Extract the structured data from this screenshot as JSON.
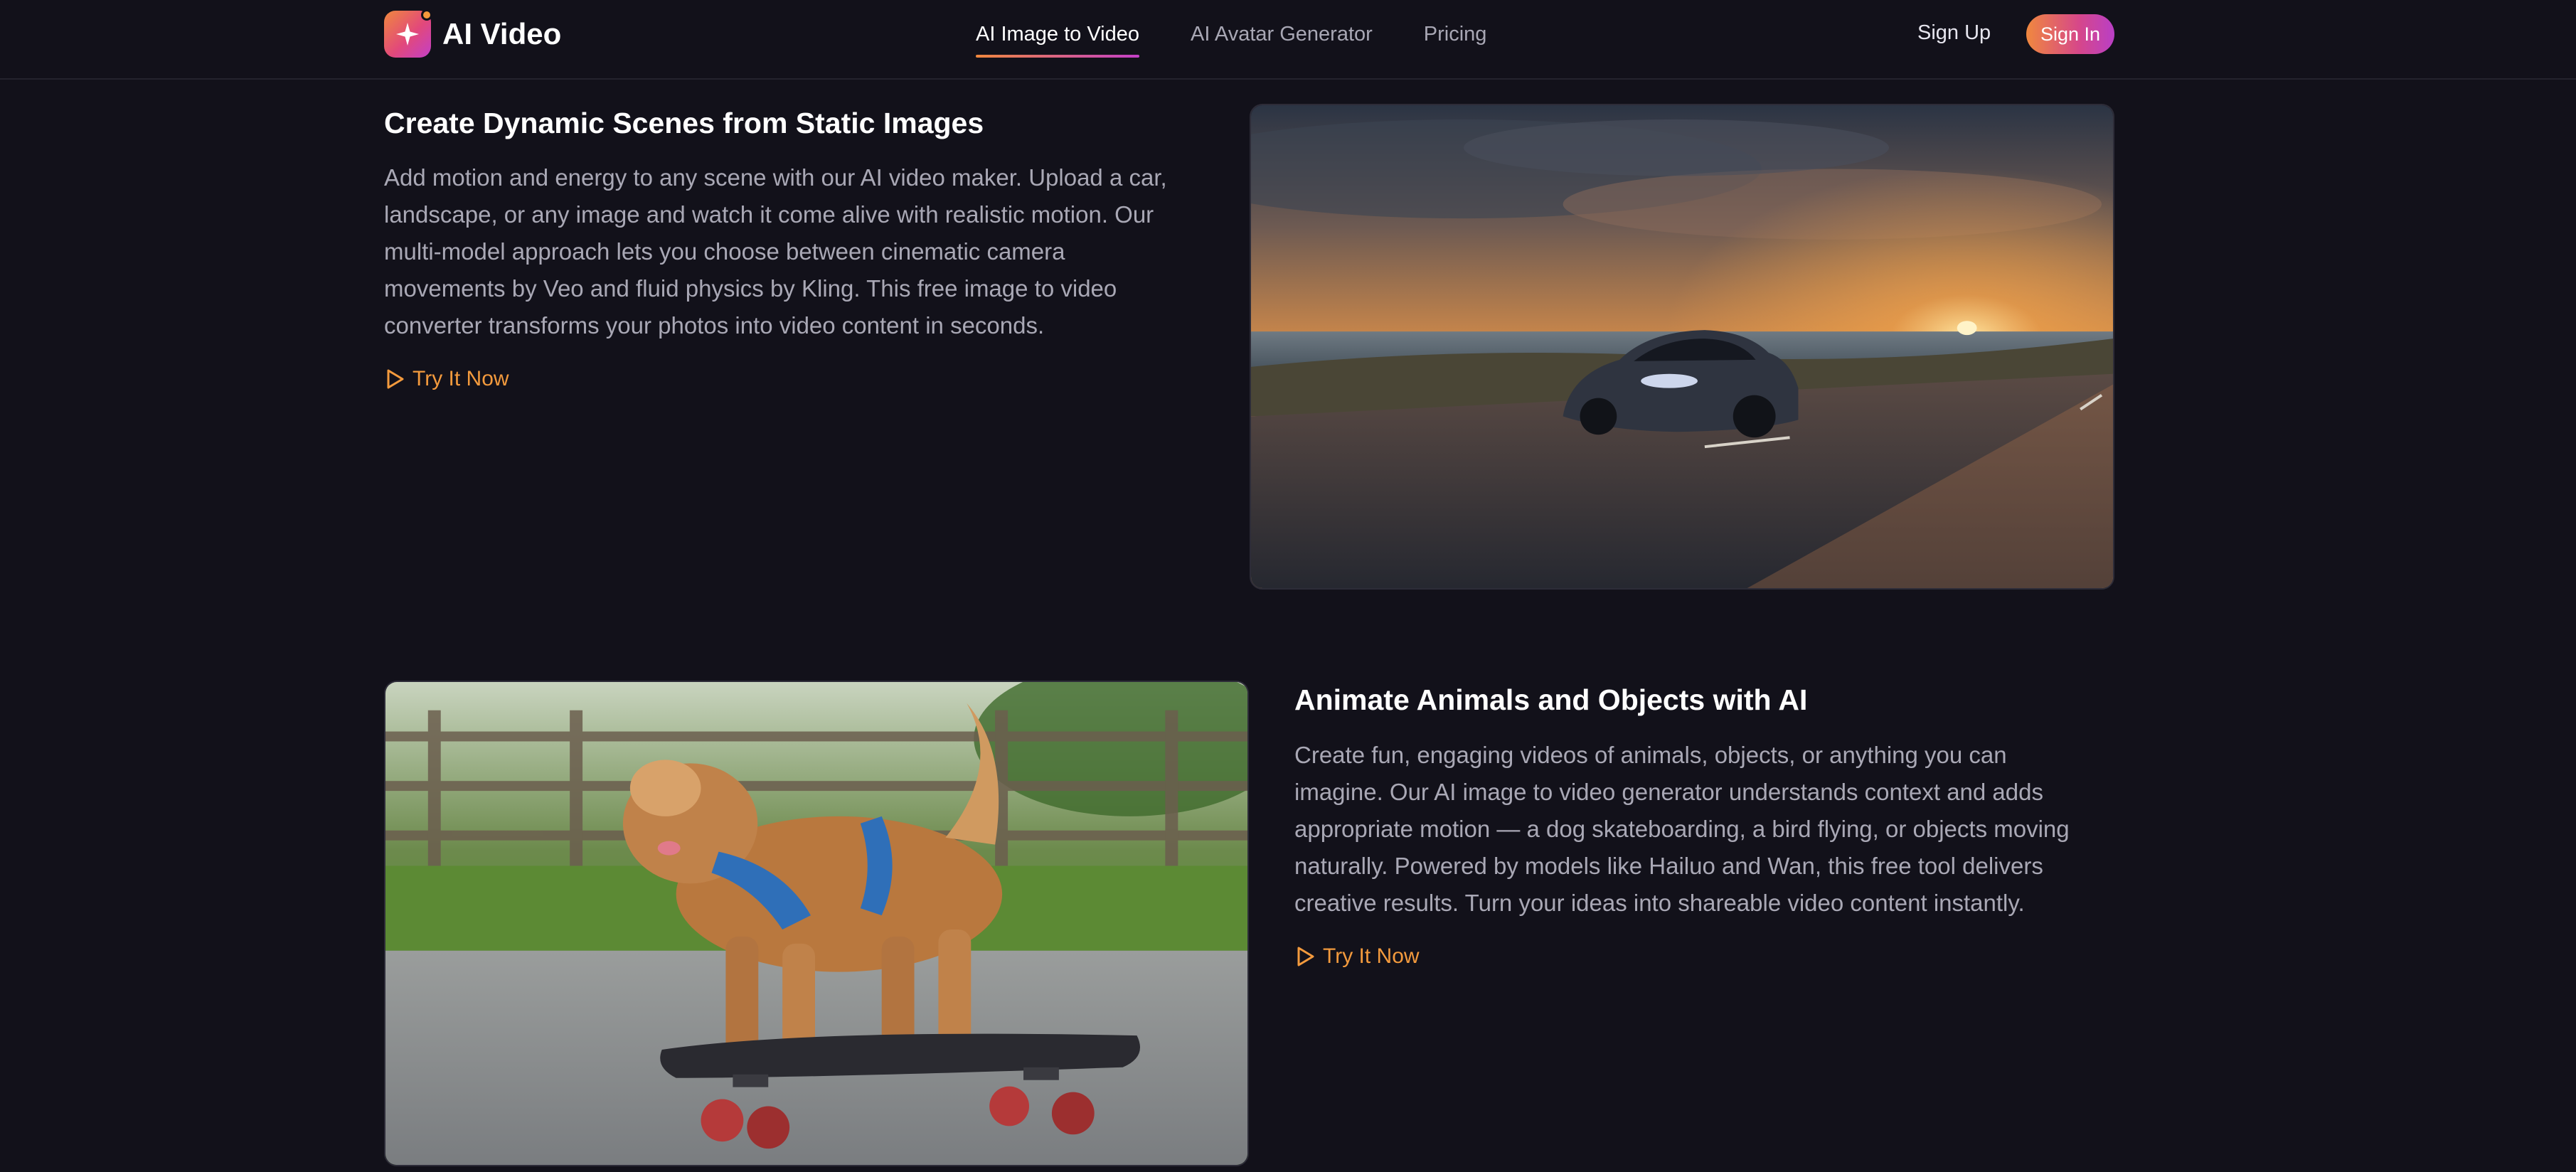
{
  "header": {
    "brand": "AI Video",
    "logo_icon": "sparkle-icon",
    "nav": [
      {
        "label": "AI Image to Video",
        "active": true
      },
      {
        "label": "AI Avatar Generator",
        "active": false
      },
      {
        "label": "Pricing",
        "active": false
      }
    ],
    "sign_up": "Sign Up",
    "sign_in": "Sign In"
  },
  "sections": [
    {
      "title": "Create Dynamic Scenes from Static Images",
      "lines": [
        "Add motion and energy to any scene with our AI video maker. Upload a car,",
        "landscape, or any image and watch it come alive with realistic motion. Our",
        "multi-model approach lets you choose between cinematic camera",
        "movements by Veo and fluid physics by Kling. This free image to video",
        "converter transforms your photos into video content in seconds."
      ],
      "cta": "Try It Now",
      "cta_icon": "play-outline-icon",
      "image": "sports-car-sunset-coast-road"
    },
    {
      "title": "Animate Animals and Objects with AI",
      "lines": [
        "Create fun, engaging videos of animals, objects, or anything you can",
        "imagine. Our AI image to video generator understands context and adds",
        "appropriate motion — a dog skateboarding, a bird flying, or objects moving",
        "naturally. Powered by models like Hailuo and Wan, this free tool delivers",
        "creative results. Turn your ideas into shareable video content instantly."
      ],
      "cta": "Try It Now",
      "cta_icon": "play-outline-icon",
      "image": "fluffy-dog-on-skateboard"
    }
  ],
  "colors": {
    "background": "#12111a",
    "accent_orange": "#f39a3d",
    "accent_pink": "#d6478a",
    "text_muted": "#a9a8b5"
  }
}
